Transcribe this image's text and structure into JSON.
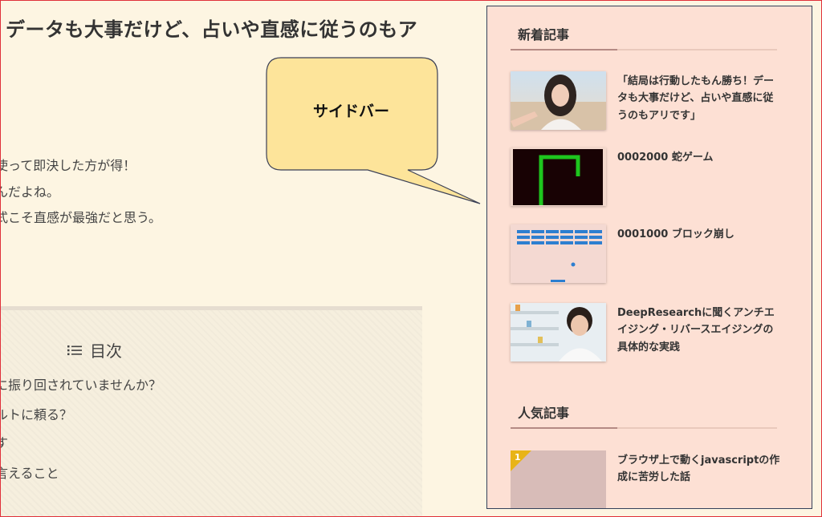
{
  "article": {
    "title": "データも大事だけど、占いや直感に従うのもア",
    "body_lines": [
      "使って即決した方が得！",
      "んだよね。",
      "式こそ直感が最強だと思う。"
    ]
  },
  "toc": {
    "title": "目次",
    "items": [
      "に振り回されていませんか？",
      "ルトに頼る？",
      "す",
      "言えること"
    ]
  },
  "callout": {
    "label": "サイドバー"
  },
  "sidebar": {
    "new_posts": {
      "heading": "新着記事",
      "posts": [
        {
          "title": "「結局は行動したもん勝ち！データも大事だけど、占いや直感に従うのもアリです」"
        },
        {
          "title": "0002000 蛇ゲーム"
        },
        {
          "title": "0001000 ブロック崩し"
        },
        {
          "title": "DeepResearchに聞くアンチエイジング・リバースエイジングの具体的な実践"
        }
      ]
    },
    "popular_posts": {
      "heading": "人気記事",
      "posts": [
        {
          "rank": "1",
          "title": "ブラウザ上で動くjavascriptの作成に苦労した話"
        }
      ]
    }
  },
  "colors": {
    "page_bg": "#fdf5e2",
    "sidebar_bg": "#fde0d4",
    "callout_fill": "#fde49a",
    "frame_border": "#e0303a",
    "rank_gold": "#e8b417",
    "snake_green": "#1ec51e",
    "brick_blue": "#2d7fd0"
  }
}
